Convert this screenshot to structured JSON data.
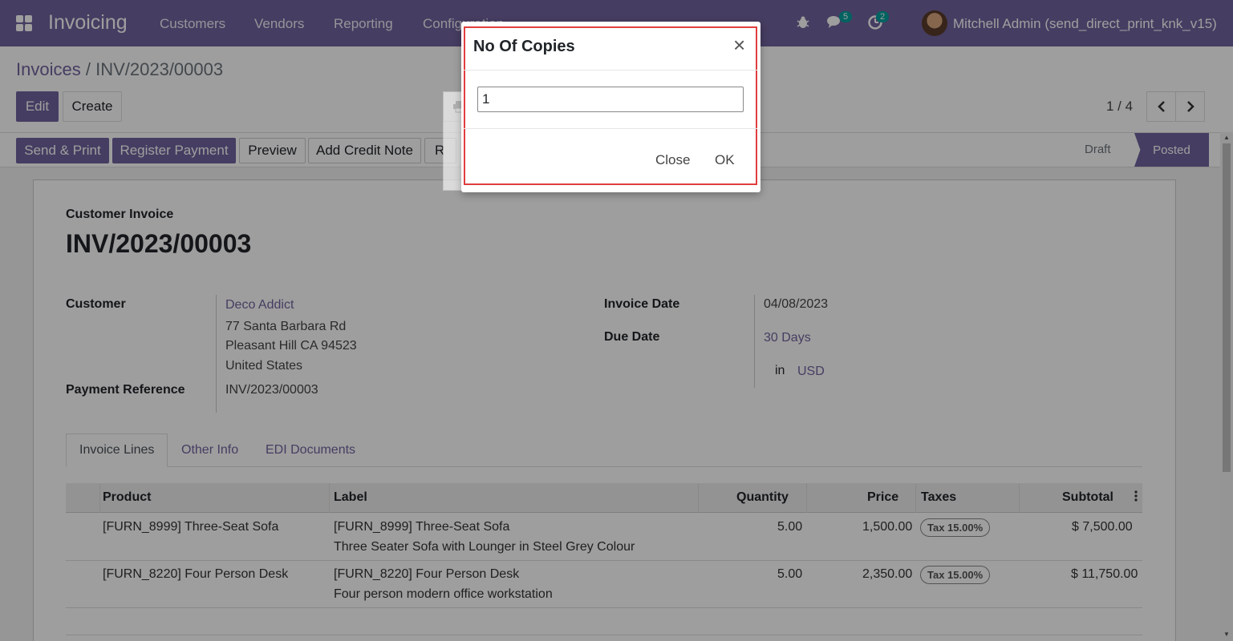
{
  "navbar": {
    "app_title": "Invoicing",
    "menus": [
      "Customers",
      "Vendors",
      "Reporting",
      "Configuration"
    ],
    "messages_count": "5",
    "activities_count": "2",
    "user_name": "Mitchell Admin (send_direct_print_knk_v15)"
  },
  "breadcrumb": {
    "parent": "Invoices",
    "separator": "/",
    "current": "INV/2023/00003"
  },
  "control": {
    "edit_label": "Edit",
    "create_label": "Create",
    "pager": "1 / 4"
  },
  "statusbar": {
    "buttons": [
      "Send & Print",
      "Register Payment",
      "Preview",
      "Add Credit Note",
      "R"
    ],
    "stages": [
      "Draft",
      "Posted"
    ],
    "active_stage": "Posted"
  },
  "invoice": {
    "type_label": "Customer Invoice",
    "name": "INV/2023/00003",
    "customer_label": "Customer",
    "customer_name": "Deco Addict",
    "address": [
      "77 Santa Barbara Rd",
      "Pleasant Hill CA 94523",
      "United States"
    ],
    "payment_ref_label": "Payment Reference",
    "payment_ref": "INV/2023/00003",
    "invoice_date_label": "Invoice Date",
    "invoice_date": "04/08/2023",
    "due_date_label": "Due Date",
    "due_terms": "30 Days",
    "currency_in": "in",
    "currency": "USD"
  },
  "tabs": [
    "Invoice Lines",
    "Other Info",
    "EDI Documents"
  ],
  "table": {
    "headers": [
      "Product",
      "Label",
      "Quantity",
      "Price",
      "Taxes",
      "Subtotal"
    ],
    "rows": [
      {
        "product": "[FURN_8999] Three-Seat Sofa",
        "label1": "[FURN_8999] Three-Seat Sofa",
        "label2": "Three Seater Sofa with Lounger in Steel Grey Colour",
        "quantity": "5.00",
        "price": "1,500.00",
        "tax": "Tax 15.00%",
        "subtotal": "$ 7,500.00"
      },
      {
        "product": "[FURN_8220] Four Person Desk",
        "label1": "[FURN_8220] Four Person Desk",
        "label2": "Four person modern office workstation",
        "quantity": "5.00",
        "price": "2,350.00",
        "tax": "Tax 15.00%",
        "subtotal": "$ 11,750.00"
      }
    ]
  },
  "modal": {
    "title": "No Of Copies",
    "close_symbol": "×",
    "copies_value": "1",
    "close_label": "Close",
    "ok_label": "OK"
  },
  "colors": {
    "brand": "#71639e",
    "highlight": "#e03e3e"
  }
}
